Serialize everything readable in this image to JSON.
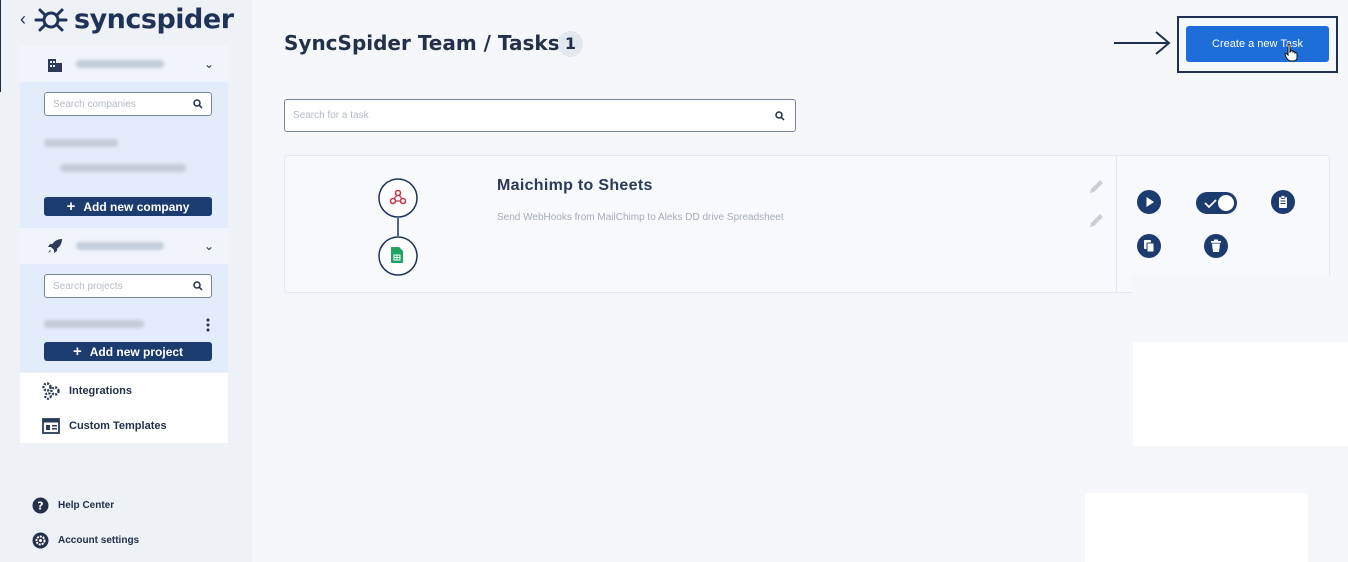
{
  "brand": {
    "back": "‹",
    "name": "syncspider"
  },
  "sidebar": {
    "companies": {
      "search_placeholder": "Search companies",
      "add_label": "Add new company"
    },
    "projects": {
      "search_placeholder": "Search projects",
      "add_label": "Add new project"
    },
    "nav": [
      {
        "label": "Integrations",
        "icon": "gears-icon"
      },
      {
        "label": "Custom Templates",
        "icon": "templates-icon"
      }
    ],
    "footer": [
      {
        "label": "Help Center",
        "icon": "help-icon"
      },
      {
        "label": "Account settings",
        "icon": "settings-icon"
      }
    ]
  },
  "header": {
    "title": "SyncSpider Team / Tasks",
    "count": "1",
    "create_label": "Create a new Task"
  },
  "task_search": {
    "placeholder": "Search for a task"
  },
  "tasks": [
    {
      "name": "Maichimp to Sheets",
      "description": "Send WebHooks from MailChimp to Aleks DD drive Spreadsheet",
      "source_icon": "webhooks-icon",
      "target_icon": "google-sheets-icon",
      "active": true
    }
  ],
  "colors": {
    "primary": "#1d6ed8",
    "navy": "#1c3b6e",
    "text": "#22304a"
  }
}
